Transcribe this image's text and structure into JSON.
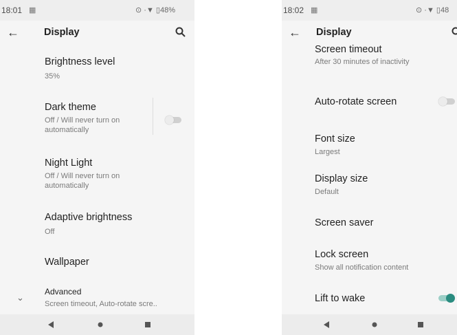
{
  "left": {
    "status": {
      "time": "18:01",
      "battery": "48%"
    },
    "toolbar": {
      "title": "Display"
    },
    "items": [
      {
        "title": "Brightness level",
        "subtitle": "35%"
      },
      {
        "title": "Dark theme",
        "subtitle": "Off / Will never turn on\nautomatically",
        "toggle": "off"
      },
      {
        "title": "Night Light",
        "subtitle": "Off / Will never turn on\nautomatically"
      },
      {
        "title": "Adaptive brightness",
        "subtitle": "Off"
      },
      {
        "title": "Wallpaper"
      },
      {
        "title": "Advanced",
        "subtitle": "Screen timeout, Auto-rotate scre.."
      }
    ]
  },
  "right": {
    "status": {
      "time": "18:02",
      "battery": "48"
    },
    "toolbar": {
      "title": "Display"
    },
    "items": [
      {
        "title": "Screen timeout",
        "subtitle": "After 30 minutes of inactivity"
      },
      {
        "title": "Auto-rotate screen",
        "toggle": "off"
      },
      {
        "title": "Font size",
        "subtitle": "Largest"
      },
      {
        "title": "Display size",
        "subtitle": "Default"
      },
      {
        "title": "Screen saver"
      },
      {
        "title": "Lock screen",
        "subtitle": "Show all notification content"
      },
      {
        "title": "Lift to wake",
        "toggle": "on"
      }
    ]
  },
  "colors": {
    "accent": "#2a8c80",
    "background": "#f5f5f5",
    "bars": "#eeeeee"
  }
}
